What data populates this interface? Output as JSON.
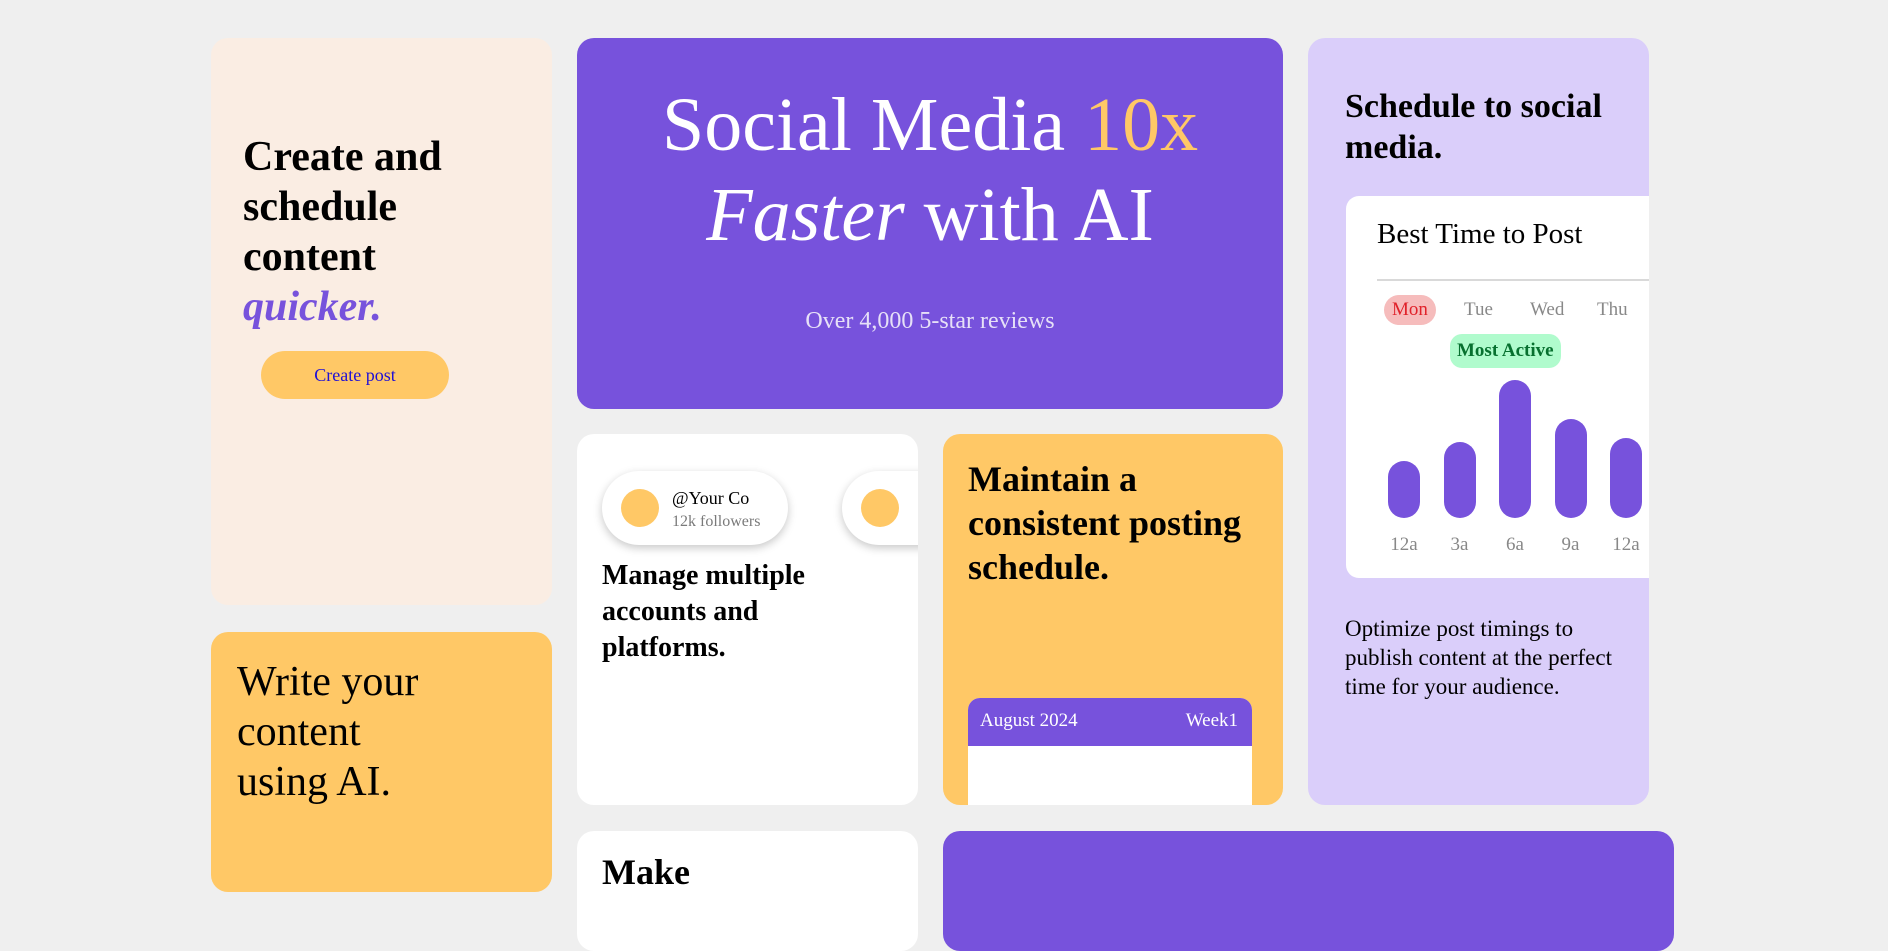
{
  "create_card": {
    "title_line1": "Create and",
    "title_line2": "schedule",
    "title_line3": "content",
    "title_accent": "quicker.",
    "button_label": "Create post"
  },
  "hero": {
    "headline_part1": "Social Media ",
    "headline_accent": "10x",
    "headline_italic": "Faster",
    "headline_part2": " with AI",
    "reviews": "Over 4,000 5-star reviews"
  },
  "accounts_card": {
    "accounts": [
      {
        "handle": "@Your Co",
        "followers": "12k followers"
      }
    ],
    "title": "Manage multiple accounts and platforms."
  },
  "consistent_card": {
    "title": "Maintain a consistent posting schedule.",
    "calendar": {
      "month": "August 2024",
      "week": "Week1"
    }
  },
  "social_card": {
    "title": "Schedule to social media.",
    "best_time": {
      "title": "Best Time to Post",
      "days": [
        "Mon",
        "Tue",
        "Wed",
        "Thu"
      ],
      "active_day": "Mon",
      "badge": "Most Active",
      "chart_data": {
        "type": "bar",
        "categories": [
          "12a",
          "3a",
          "6a",
          "9a",
          "12a"
        ],
        "values": [
          0.41,
          0.55,
          1.0,
          0.72,
          0.58
        ]
      }
    },
    "description": "Optimize post timings to publish content at the perfect time for your audience."
  },
  "write_card": {
    "title_line1": "Write your",
    "title_line2": "content",
    "title_line3": "using AI."
  },
  "bottom_peek": {
    "text": "Make"
  },
  "colors": {
    "purple": "#7752dc",
    "yellow": "#ffc866",
    "peach": "#faede3",
    "lavender": "#dacefa",
    "mint": "#b0fbcd"
  }
}
